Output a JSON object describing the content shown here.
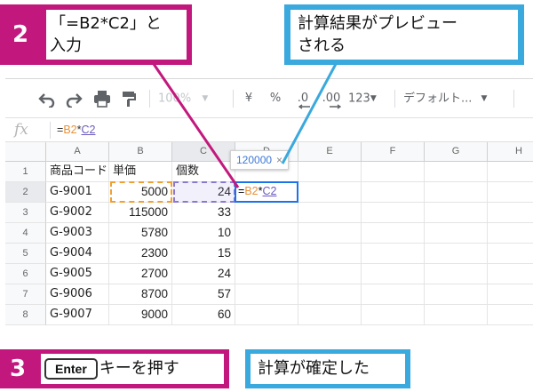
{
  "toolbar": {
    "undo_icon": "undo-icon",
    "redo_icon": "redo-icon",
    "print_icon": "print-icon",
    "paint_format_icon": "paint-format-icon",
    "zoom": "100%",
    "currency": "¥",
    "percent": "%",
    "decrease_decimal": ".0",
    "increase_decimal": ".00",
    "more_formats": "123",
    "font": "デフォルト..."
  },
  "formula_bar": {
    "fx_label": "fx",
    "formula_prefix": "=",
    "formula_ref1": "B2",
    "formula_op": "*",
    "formula_ref2": "C2"
  },
  "grid": {
    "columns": [
      "A",
      "B",
      "C",
      "D",
      "E",
      "F",
      "G",
      "H"
    ],
    "rows": [
      "1",
      "2",
      "3",
      "4",
      "5",
      "6",
      "7",
      "8"
    ],
    "header_row": [
      "商品コード",
      "単価",
      "個数"
    ],
    "data": [
      [
        "G-9001",
        "5000",
        "24"
      ],
      [
        "G-9002",
        "115000",
        "33"
      ],
      [
        "G-9003",
        "5780",
        "10"
      ],
      [
        "G-9004",
        "2300",
        "15"
      ],
      [
        "G-9005",
        "2700",
        "24"
      ],
      [
        "G-9006",
        "8700",
        "57"
      ],
      [
        "G-9007",
        "9000",
        "60"
      ]
    ],
    "active_cell": {
      "prefix": "=",
      "ref1": "B2",
      "op": "*",
      "ref2": "C2"
    },
    "preview": {
      "value": "120000",
      "close": "×"
    }
  },
  "callouts": {
    "step2": {
      "number": "2",
      "line1": "「=B2*C2」と",
      "line2": "入力"
    },
    "preview_note": {
      "line1": "計算結果がプレビュー",
      "line2": "される"
    },
    "step3": {
      "number": "3",
      "key": "Enter",
      "text": "キーを押す"
    },
    "confirm_note": {
      "text": "計算が確定した"
    }
  },
  "colors": {
    "callout_magenta": "#c2187d",
    "callout_blue": "#3aa9dd",
    "ref_orange": "#e69138",
    "ref_purple": "#6d5bbf",
    "selection_blue": "#1a73e8"
  }
}
